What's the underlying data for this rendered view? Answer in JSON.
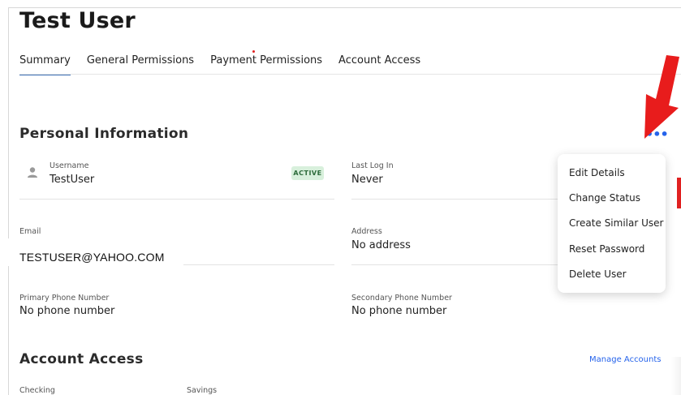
{
  "page": {
    "title": "Test User"
  },
  "tabs": [
    {
      "label": "Summary",
      "active": true
    },
    {
      "label": "General Permissions",
      "active": false
    },
    {
      "label": "Payment Permissions",
      "active": false
    },
    {
      "label": "Account Access",
      "active": false
    }
  ],
  "personal": {
    "title": "Personal Information",
    "more_label": "•••",
    "username_label": "Username",
    "username_value": "TestUser",
    "status_badge": "ACTIVE",
    "last_login_label": "Last Log In",
    "last_login_value": "Never",
    "email_label": "Email",
    "email_value": "TESTUSER@YAHOO.COM",
    "address_label": "Address",
    "address_value": "No address",
    "primary_phone_label": "Primary Phone Number",
    "primary_phone_value": "No phone number",
    "secondary_phone_label": "Secondary Phone Number",
    "secondary_phone_value": "No phone number"
  },
  "menu": {
    "items": [
      "Edit Details",
      "Change Status",
      "Create Similar User",
      "Reset Password",
      "Delete User"
    ]
  },
  "account_access": {
    "title": "Account Access",
    "manage_label": "Manage Accounts",
    "columns": [
      "Checking",
      "Savings"
    ]
  },
  "colors": {
    "accent": "#2563eb",
    "tab_underline": "#3b6fb6",
    "badge_bg": "#d8f0dc",
    "badge_text": "#2c6b3a",
    "annotation_red": "#e02020"
  },
  "icons": {
    "user": "user-icon",
    "more": "more-options-icon",
    "annotation": "red-arrow-icon"
  }
}
